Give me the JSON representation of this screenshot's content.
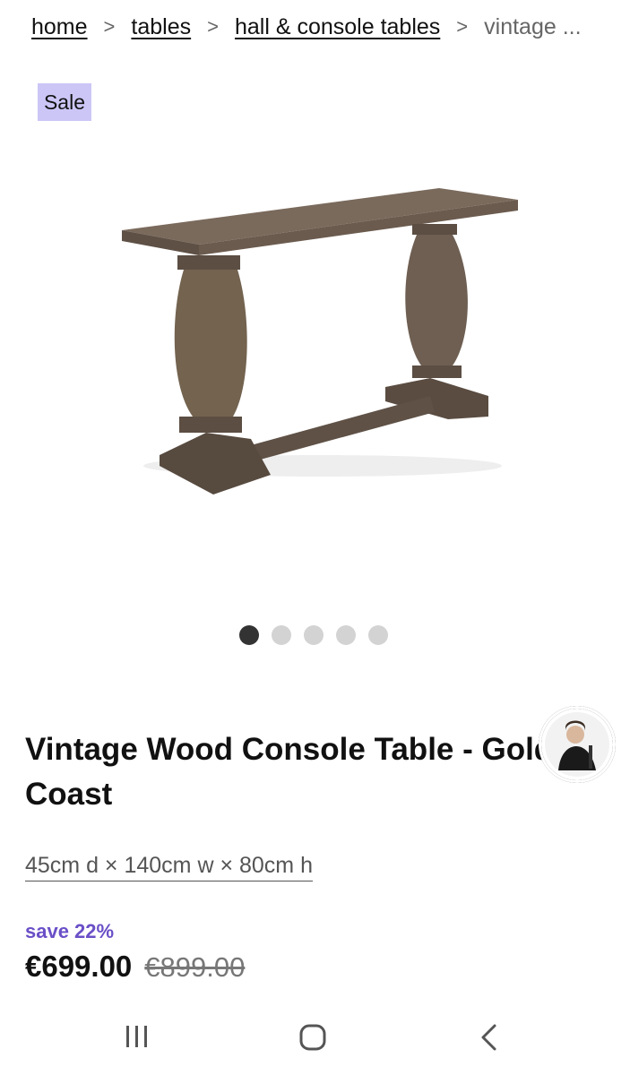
{
  "breadcrumb": {
    "items": [
      "home",
      "tables",
      "hall & console tables"
    ],
    "separator": ">",
    "current": "vintage ..."
  },
  "badge": {
    "label": "Sale",
    "color": "#cbc6f6"
  },
  "carousel": {
    "total": 5,
    "active_index": 0
  },
  "product": {
    "title": "Vintage Wood Console Table - Gold Coast",
    "dimensions": "45cm d × 140cm w × 80cm h",
    "save_text": "save 22%",
    "price": "€699.00",
    "old_price": "€899.00"
  },
  "colors": {
    "accent": "#6a4fc7",
    "text": "#111111",
    "muted": "#666666",
    "wood": "#6b5a4c"
  },
  "icons": {
    "recent_apps": "recent-apps-icon",
    "home": "home-icon",
    "back": "back-icon"
  }
}
